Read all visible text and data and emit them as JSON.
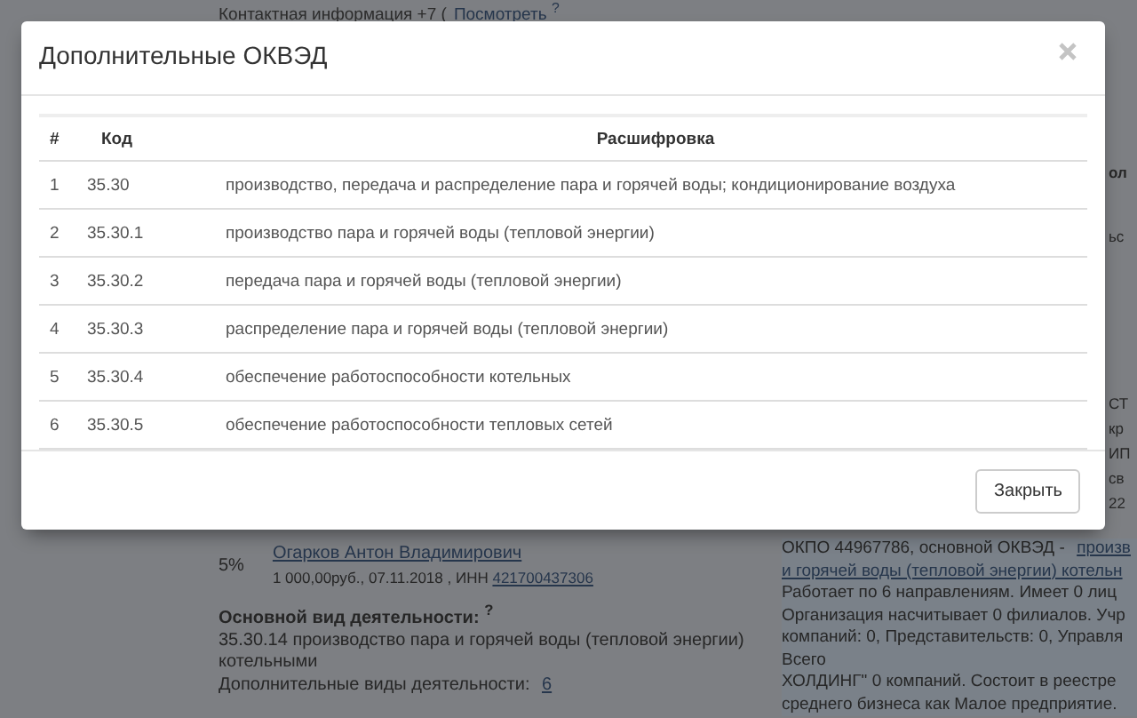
{
  "background": {
    "contact_label": "Контактная информация +7 (",
    "contact_link": "Посмотреть $^{?}$",
    "side_fragments": [
      "ол",
      "ьс",
      "СТ",
      "кр",
      "ИП",
      "св",
      "22"
    ],
    "owner": {
      "share": "5%",
      "name": "Огарков Антон Владимирович",
      "details": "1 000,00руб., 07.11.2018 , ИНН ",
      "inn": "421700437306"
    },
    "main_activity_heading": "Основной вид деятельности: $^{?}$",
    "main_activity": "35.30.14 производство пара и горячей воды (тепловой энергии) котельными",
    "extra_activity_label": "Дополнительные виды деятельности: ",
    "extra_activity_count": "6",
    "summary_prefix": "ОКПО 44967786, основной ОКВЭД - ",
    "summary_link": "произв",
    "summary_link_2": "и горячей воды (тепловой энергии) котельн",
    "summary_lines": [
      "Работает по 6 направлениям. Имеет 0 лиц",
      "Организация насчитывает 0 филиалов. Учр",
      "компаний: 0, Представительств: 0, Управля",
      "Всего",
      "ХОЛДИНГ\" 0 компаний. Состоит в реестре",
      "среднего бизнеса как Малое предприятие."
    ]
  },
  "modal": {
    "title": "Дополнительные ОКВЭД",
    "close_button": "Закрыть",
    "table": {
      "columns": [
        "#",
        "Код",
        "Расшифровка"
      ],
      "rows": [
        [
          "1",
          "35.30",
          "производство, передача и распределение пара и горячей воды; кондиционирование воздуха"
        ],
        [
          "2",
          "35.30.1",
          "производство пара и горячей воды (тепловой энергии)"
        ],
        [
          "3",
          "35.30.2",
          "передача пара и горячей воды (тепловой энергии)"
        ],
        [
          "4",
          "35.30.3",
          "распределение пара и горячей воды (тепловой энергии)"
        ],
        [
          "5",
          "35.30.4",
          "обеспечение работоспособности котельных"
        ],
        [
          "6",
          "35.30.5",
          "обеспечение работоспособности тепловых сетей"
        ]
      ]
    }
  }
}
